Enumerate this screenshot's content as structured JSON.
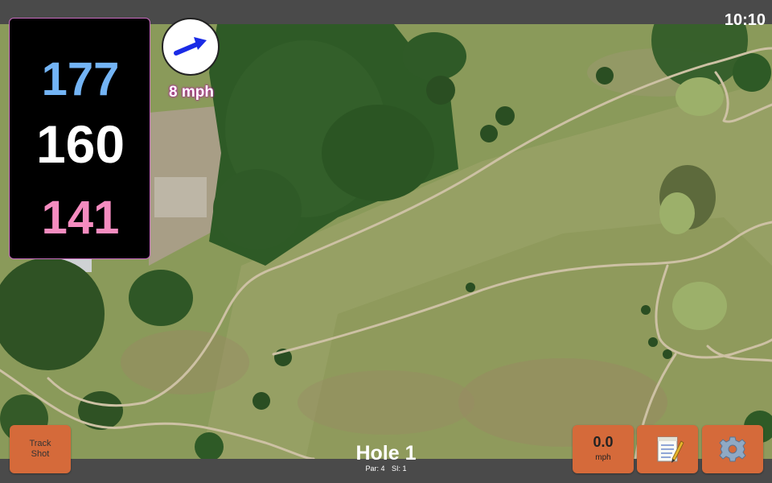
{
  "status": {
    "time": "10:10"
  },
  "distances": {
    "back": "177",
    "middle": "160",
    "front": "141"
  },
  "wind": {
    "speed_label": "8 mph",
    "arrow_color": "#1a2be6"
  },
  "buttons": {
    "track_shot": "Track Shot",
    "speed_value": "0.0",
    "speed_unit": "mph",
    "notes_icon": "notepad-icon",
    "settings_icon": "gear-icon"
  },
  "hole": {
    "title": "Hole 1",
    "par": "Par: 4",
    "si": "SI: 1"
  },
  "colors": {
    "back": "#73b4f5",
    "middle": "#ffffff",
    "front": "#f58cc0",
    "button": "#d56a3a",
    "panel_border": "#c86bc0"
  }
}
